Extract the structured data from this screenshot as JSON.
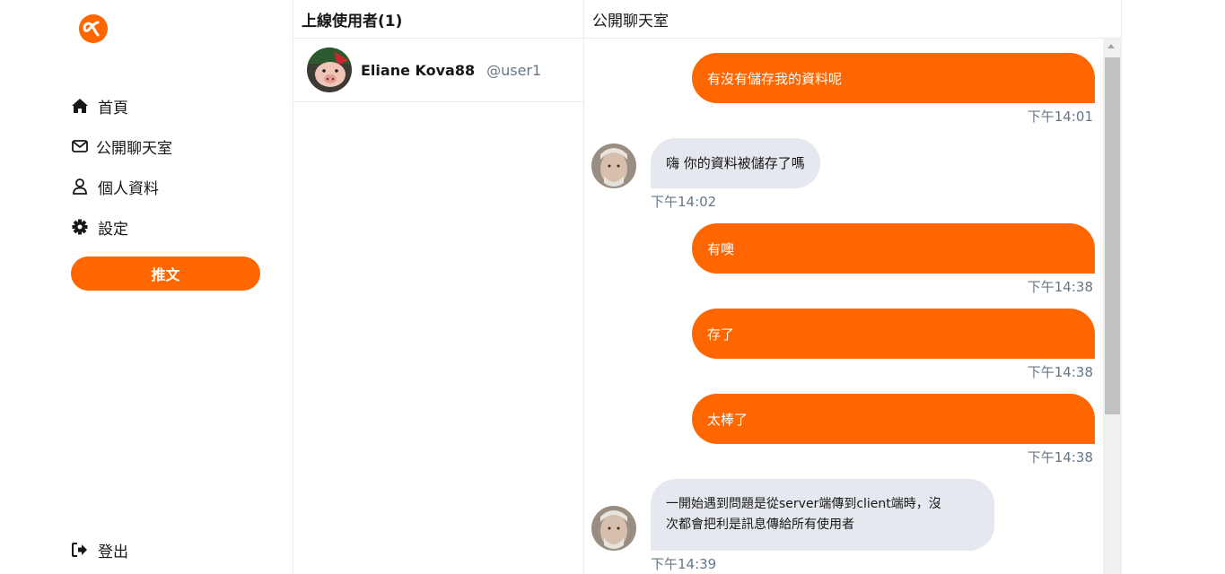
{
  "brand": {
    "logo_icon": "alpha-logo-icon",
    "accent_color": "#ff6600"
  },
  "sidebar": {
    "items": [
      {
        "label": "首頁",
        "icon": "home-icon"
      },
      {
        "label": "公開聊天室",
        "icon": "envelope-icon"
      },
      {
        "label": "個人資料",
        "icon": "user-icon"
      },
      {
        "label": "設定",
        "icon": "gear-icon"
      }
    ],
    "tweet_button": "推文",
    "logout": {
      "label": "登出",
      "icon": "logout-icon"
    }
  },
  "online_users": {
    "title": "上線使用者(1)",
    "users": [
      {
        "name": "Eliane Kova88",
        "account": "@user1"
      }
    ]
  },
  "chat": {
    "title": "公開聊天室",
    "messages": [
      {
        "direction": "out",
        "text": "有沒有儲存我的資料呢",
        "time": "下午14:01"
      },
      {
        "direction": "in",
        "text": "嗨 你的資料被儲存了嗎",
        "time": "下午14:02"
      },
      {
        "direction": "out",
        "text": "有噢",
        "time": "下午14:38"
      },
      {
        "direction": "out",
        "text": "存了",
        "time": "下午14:38"
      },
      {
        "direction": "out",
        "text": "太棒了",
        "time": "下午14:38"
      },
      {
        "direction": "in",
        "line1": "一開始遇到問題是從server端傳到client端時，沒",
        "line2": "次都會把利是訊息傳給所有使用者",
        "time": "下午14:39"
      }
    ]
  }
}
